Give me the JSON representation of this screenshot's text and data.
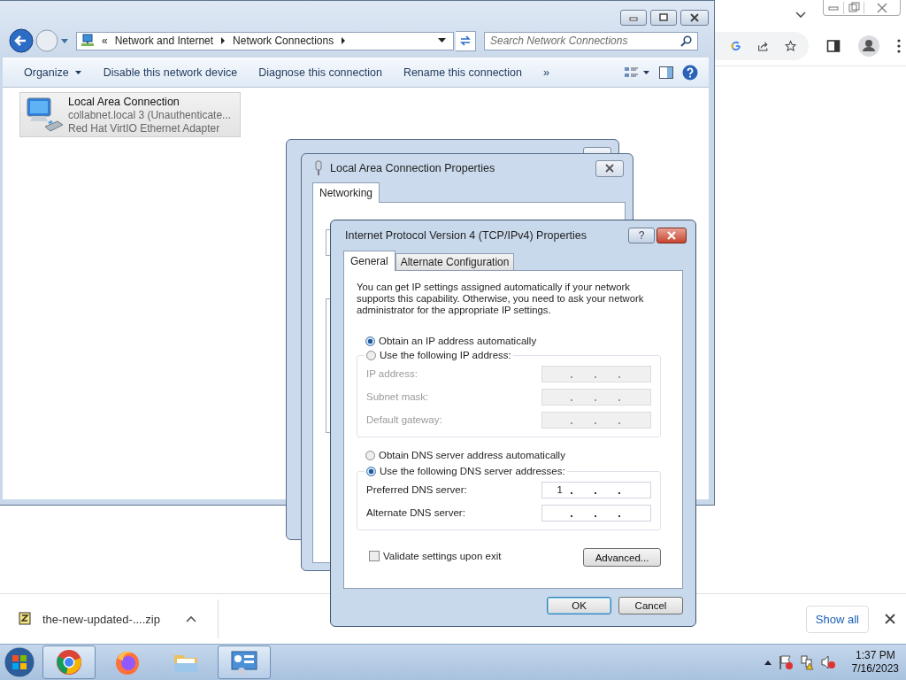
{
  "explorer": {
    "breadcrumb_prefix": "«",
    "breadcrumb": [
      "Network and Internet",
      "Network Connections"
    ],
    "search": {
      "placeholder": "Search Network Connections"
    },
    "organize": "Organize",
    "commands": [
      "Disable this network device",
      "Diagnose this connection",
      "Rename this connection"
    ],
    "more": "»",
    "connections": [
      {
        "name": "Local Area Connection",
        "network": "collabnet.local  3 (Unauthenticate...",
        "adapter": "Red Hat VirtIO Ethernet Adapter",
        "selected": true
      }
    ]
  },
  "properties": {
    "title": "Local Area Connection Properties",
    "tabs": [
      {
        "label": "Networking",
        "selected": true
      }
    ]
  },
  "ipv4": {
    "title": "Internet Protocol Version 4 (TCP/IPv4) Properties",
    "help": "?",
    "tabs": [
      {
        "label": "General",
        "selected": true
      },
      {
        "label": "Alternate Configuration",
        "selected": false
      }
    ],
    "intro": "You can get IP settings assigned automatically if your network supports this capability. Otherwise, you need to ask your network administrator for the appropriate IP settings.",
    "ip_mode": [
      {
        "label": "Obtain an IP address automatically",
        "selected": true
      },
      {
        "label": "Use the following IP address:",
        "selected": false
      }
    ],
    "ip_fields": [
      {
        "label": "IP address:",
        "disabled": true
      },
      {
        "label": "Subnet mask:",
        "disabled": true
      },
      {
        "label": "Default gateway:",
        "disabled": true
      }
    ],
    "dns_mode": [
      {
        "label": "Obtain DNS server address automatically",
        "selected": false
      },
      {
        "label": "Use the following DNS server addresses:",
        "selected": true
      }
    ],
    "dns_fields": [
      {
        "label": "Preferred DNS server:",
        "disabled": false,
        "value": "1"
      },
      {
        "label": "Alternate DNS server:",
        "disabled": false
      }
    ],
    "validate": {
      "label": "Validate settings upon exit",
      "checked": false
    },
    "advanced": "Advanced...",
    "buttons": [
      {
        "label": "OK",
        "default": true
      },
      {
        "label": "Cancel",
        "default": false
      }
    ]
  },
  "downloads": {
    "file": "the-new-updated-....zip",
    "show_all": "Show all"
  },
  "taskbar": {
    "apps": [
      {
        "kind": "chrome",
        "open": true
      },
      {
        "kind": "firefox",
        "open": false
      },
      {
        "kind": "folder",
        "open": false
      },
      {
        "kind": "control-panel",
        "open": true
      }
    ]
  },
  "clock": {
    "time": "1:37 PM",
    "date": "7/16/2023"
  }
}
